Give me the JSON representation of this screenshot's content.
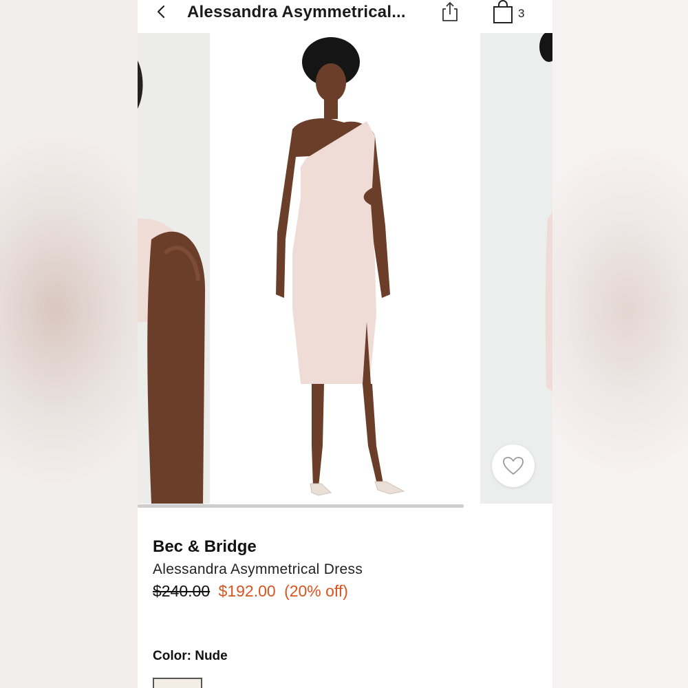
{
  "header": {
    "title": "Alessandra Asymmetrical...",
    "cart_count": "3",
    "icons": {
      "back": "chevron-left-icon",
      "share": "share-icon",
      "bag": "shopping-bag-icon"
    }
  },
  "gallery": {
    "images": [
      "product-photo-detail-shoulder",
      "product-photo-front",
      "product-photo-side"
    ],
    "favorite_icon": "heart-icon"
  },
  "product": {
    "brand": "Bec & Bridge",
    "name": "Alessandra Asymmetrical Dress",
    "original_price": "$240.00",
    "sale_price": "$192.00",
    "discount": "(20% off)"
  },
  "color": {
    "label": "Color:",
    "value": "Nude"
  },
  "colors": {
    "accent": "#d9541e",
    "dress": "#f0dcd6",
    "skin": "#6b3e2a"
  }
}
